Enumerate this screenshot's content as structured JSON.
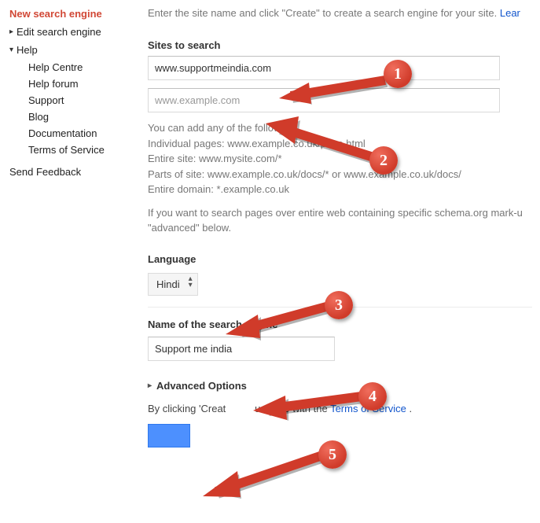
{
  "sidebar": {
    "new_engine": "New search engine",
    "edit_engine": "Edit search engine",
    "help": "Help",
    "help_sub": {
      "help_centre": "Help Centre",
      "help_forum": "Help forum",
      "support": "Support",
      "blog": "Blog",
      "documentation": "Documentation",
      "tos": "Terms of Service"
    },
    "send_feedback": "Send Feedback"
  },
  "main": {
    "instruction": "Enter the site name and click \"Create\" to create a search engine for your site.",
    "learn_more": "Lear",
    "sites_label": "Sites to search",
    "site_value": "www.supportmeindia.com",
    "site_placeholder": "www.example.com",
    "hints_intro": "You can add any of the following:",
    "hint_individual_k": "Individual pages:",
    "hint_individual_v": "www.example.co.uk/page.html",
    "hint_entire_site_k": "Entire site:",
    "hint_entire_site_v": "www.mysite.com/*",
    "hint_parts_k": "Parts of site:",
    "hint_parts_v": "www.example.co.uk/docs/* or www.example.co.uk/docs/",
    "hint_domain_k": "Entire domain:",
    "hint_domain_v": "*.example.co.uk",
    "schema_note": "If you want to search pages over entire web containing specific schema.org mark-u \"advanced\" below.",
    "language_label": "Language",
    "language_value": "Hindi",
    "name_label": "Name of the search engine",
    "name_value": "Support me india",
    "advanced": "Advanced Options",
    "agree_prefix": "By clicking 'Creat",
    "agree_mid": "u agree with the ",
    "tos_link": "Terms of Service",
    "agree_suffix": " ."
  },
  "annotations": {
    "n1": "1",
    "n2": "2",
    "n3": "3",
    "n4": "4",
    "n5": "5"
  }
}
